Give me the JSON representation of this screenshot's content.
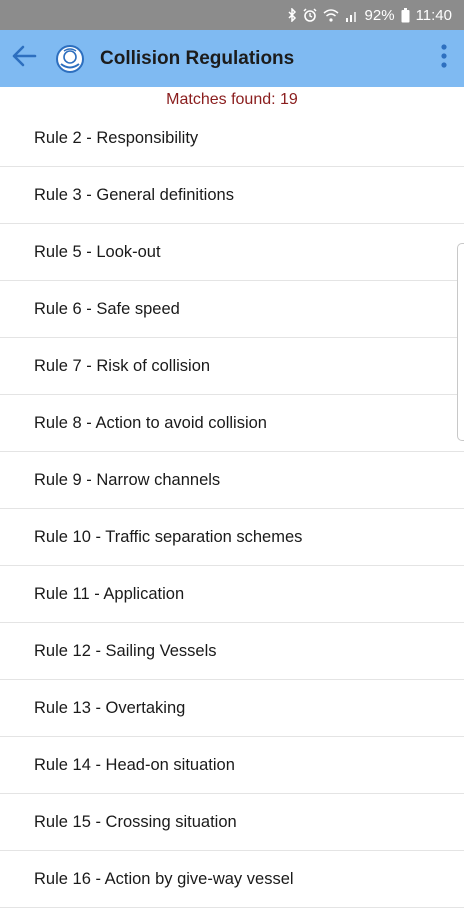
{
  "status_bar": {
    "battery": "92%",
    "time": "11:40",
    "icons": [
      "bluetooth-icon",
      "alarm-icon",
      "wifi-icon",
      "signal-icon",
      "battery-icon"
    ]
  },
  "app_bar": {
    "title": "Collision Regulations",
    "back_icon": "arrow-left-icon",
    "logo_icon": "imo-logo-icon",
    "menu_icon": "more-vert-icon",
    "background_color": "#7fbaf2"
  },
  "search": {
    "matches_label": "Matches found: 19",
    "matches_color": "#8a1d1d"
  },
  "rules": [
    {
      "label": "Rule 2 - Responsibility"
    },
    {
      "label": "Rule 3 - General definitions"
    },
    {
      "label": "Rule 5 - Look-out"
    },
    {
      "label": "Rule 6 - Safe speed"
    },
    {
      "label": "Rule 7 - Risk of collision"
    },
    {
      "label": "Rule 8 - Action to avoid collision"
    },
    {
      "label": "Rule 9 - Narrow channels"
    },
    {
      "label": "Rule 10 - Traffic separation schemes"
    },
    {
      "label": "Rule 11 - Application"
    },
    {
      "label": "Rule 12 - Sailing Vessels"
    },
    {
      "label": "Rule 13 - Overtaking"
    },
    {
      "label": "Rule 14 - Head-on situation"
    },
    {
      "label": "Rule 15 - Crossing situation"
    },
    {
      "label": "Rule 16 - Action by give-way vessel"
    }
  ]
}
